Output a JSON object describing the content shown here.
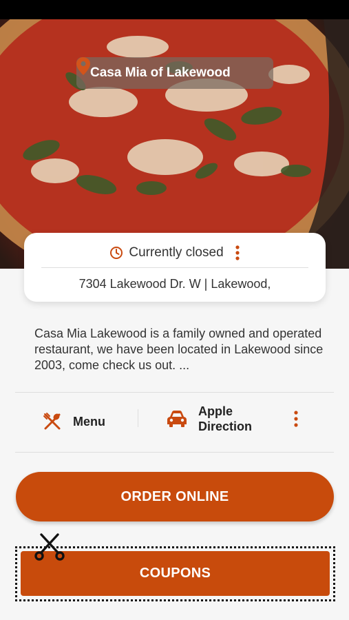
{
  "header": {
    "restaurant_name": "Casa Mia of Lakewood"
  },
  "info_card": {
    "status": "Currently closed",
    "address": "7304 Lakewood Dr. W  | Lakewood,"
  },
  "description": "Casa Mia Lakewood is a family owned and operated restaurant, we have been located in Lakewood since 2003, come check us out. ...",
  "actions": {
    "menu_label": "Menu",
    "direction_label": "Apple Direction"
  },
  "buttons": {
    "order_online": "ORDER ONLINE",
    "coupons": "COUPONS"
  },
  "icons": {
    "location": "map-pin-icon",
    "status": "clock-icon",
    "menu": "fork-spoon-icon",
    "direction": "car-icon",
    "more": "kebab-icon",
    "coupon": "scissors-icon"
  },
  "colors": {
    "accent": "#c84b0c",
    "icon_orange": "#c94a10"
  }
}
